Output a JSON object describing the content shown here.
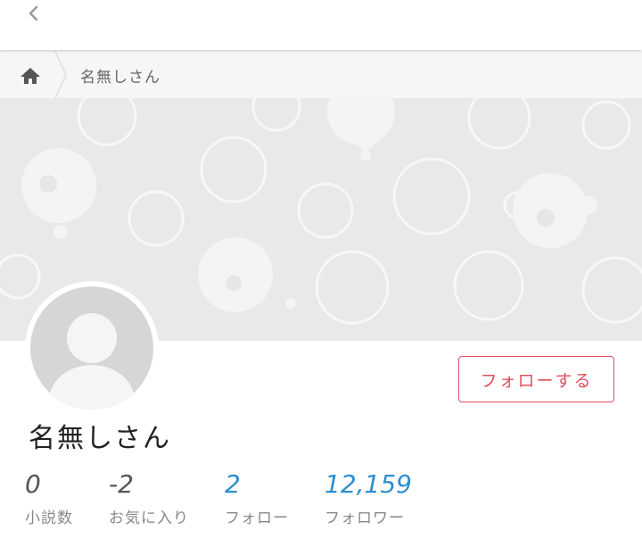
{
  "header": {
    "back_icon": "chevron-left-icon"
  },
  "breadcrumb": {
    "home_icon": "home-icon",
    "current": "名無しさん"
  },
  "profile": {
    "name": "名無しさん",
    "follow_label": "フォローする",
    "avatar_icon": "default-user-avatar"
  },
  "stats": [
    {
      "value": "0",
      "label": "小説数"
    },
    {
      "value": "-2",
      "label": "お気に入り"
    },
    {
      "value": "2",
      "label": "フォロー"
    },
    {
      "value": "12,159",
      "label": "フォロワー"
    }
  ],
  "colors": {
    "accent": "#e0505e",
    "link": "#2d8fd0",
    "cover_bg": "#e9e9e9"
  }
}
